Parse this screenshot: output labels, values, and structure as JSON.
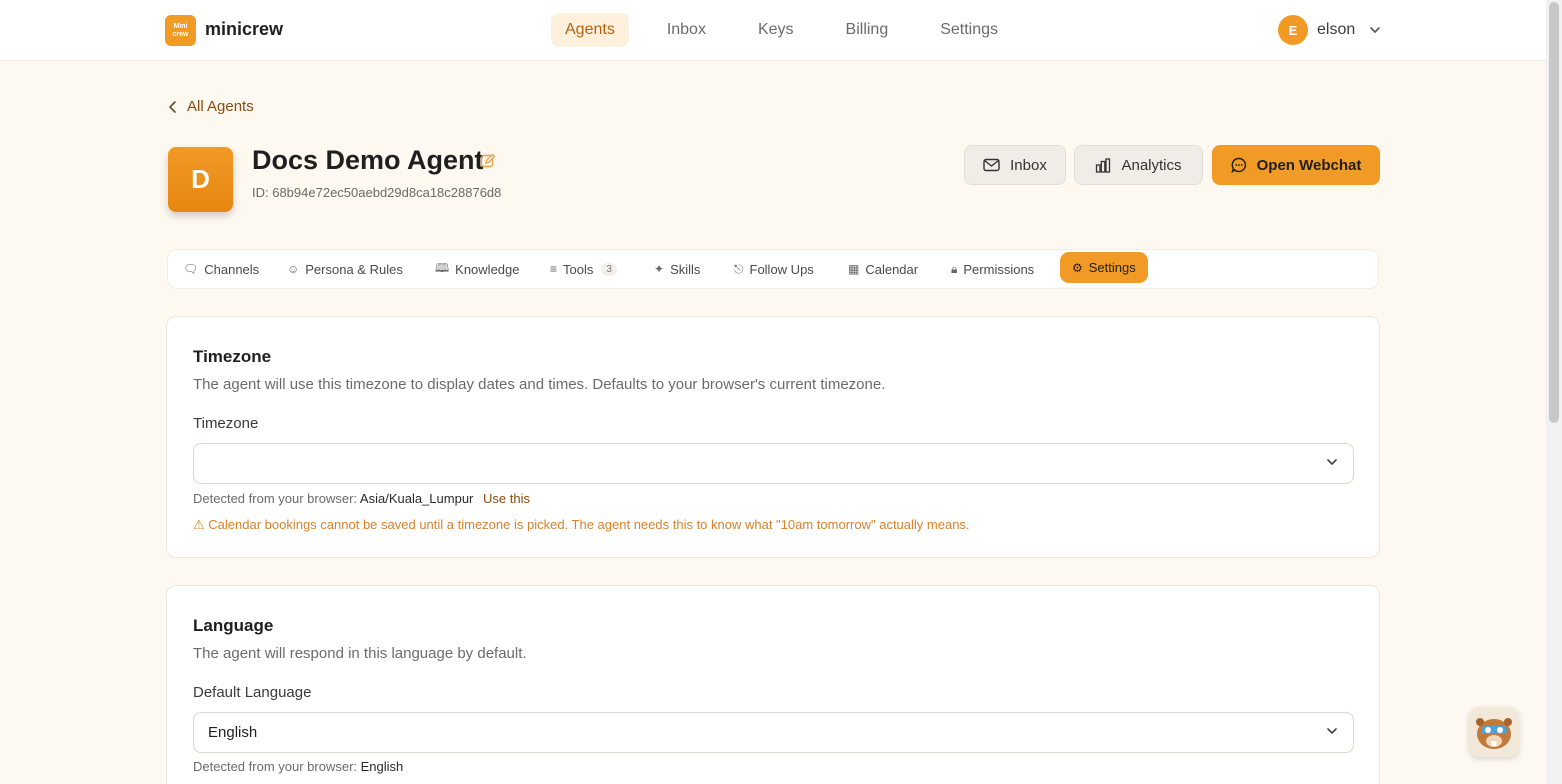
{
  "brand": {
    "logo_text_top": "Mini",
    "logo_text_bottom": "crew",
    "name": "minicrew"
  },
  "nav": {
    "items": [
      {
        "label": "Agents"
      },
      {
        "label": "Inbox"
      },
      {
        "label": "Keys"
      },
      {
        "label": "Billing"
      },
      {
        "label": "Settings"
      }
    ]
  },
  "user": {
    "initial": "E",
    "name": "elson"
  },
  "back_link": "All Agents",
  "agent": {
    "initial": "D",
    "name": "Docs Demo Agent",
    "id": "ID: 68b94e72ec50aebd29d8ca18c28876d8"
  },
  "actions": {
    "inbox": "Inbox",
    "analytics": "Analytics",
    "webchat": "Open Webchat"
  },
  "tabs": [
    {
      "label": "Channels",
      "icon": "chat-icon"
    },
    {
      "label": "Persona & Rules",
      "icon": "persona-icon"
    },
    {
      "label": "Knowledge",
      "icon": "book-icon"
    },
    {
      "label": "Tools",
      "icon": "sliders-icon",
      "badge": "3"
    },
    {
      "label": "Skills",
      "icon": "puzzle-icon"
    },
    {
      "label": "Follow Ups",
      "icon": "bell-icon"
    },
    {
      "label": "Calendar",
      "icon": "calendar-icon"
    },
    {
      "label": "Permissions",
      "icon": "lock-icon"
    },
    {
      "label": "Settings",
      "icon": "gear-icon"
    }
  ],
  "timezone": {
    "title": "Timezone",
    "description": "The agent will use this timezone to display dates and times. Defaults to your browser's current timezone.",
    "field_label": "Timezone",
    "value": "",
    "detected_prefix": "Detected from your browser:",
    "detected_value": "Asia/Kuala_Lumpur",
    "use_this": "Use this",
    "warning": "Calendar bookings cannot be saved until a timezone is picked. The agent needs this to know what \"10am tomorrow\" actually means."
  },
  "language": {
    "title": "Language",
    "description": "The agent will respond in this language by default.",
    "field_label": "Default Language",
    "value": "English",
    "detected_prefix": "Detected from your browser:",
    "detected_value": "English"
  },
  "colors": {
    "accent": "#f29a26",
    "background": "#fdf8f0",
    "warning": "#d9822b"
  }
}
